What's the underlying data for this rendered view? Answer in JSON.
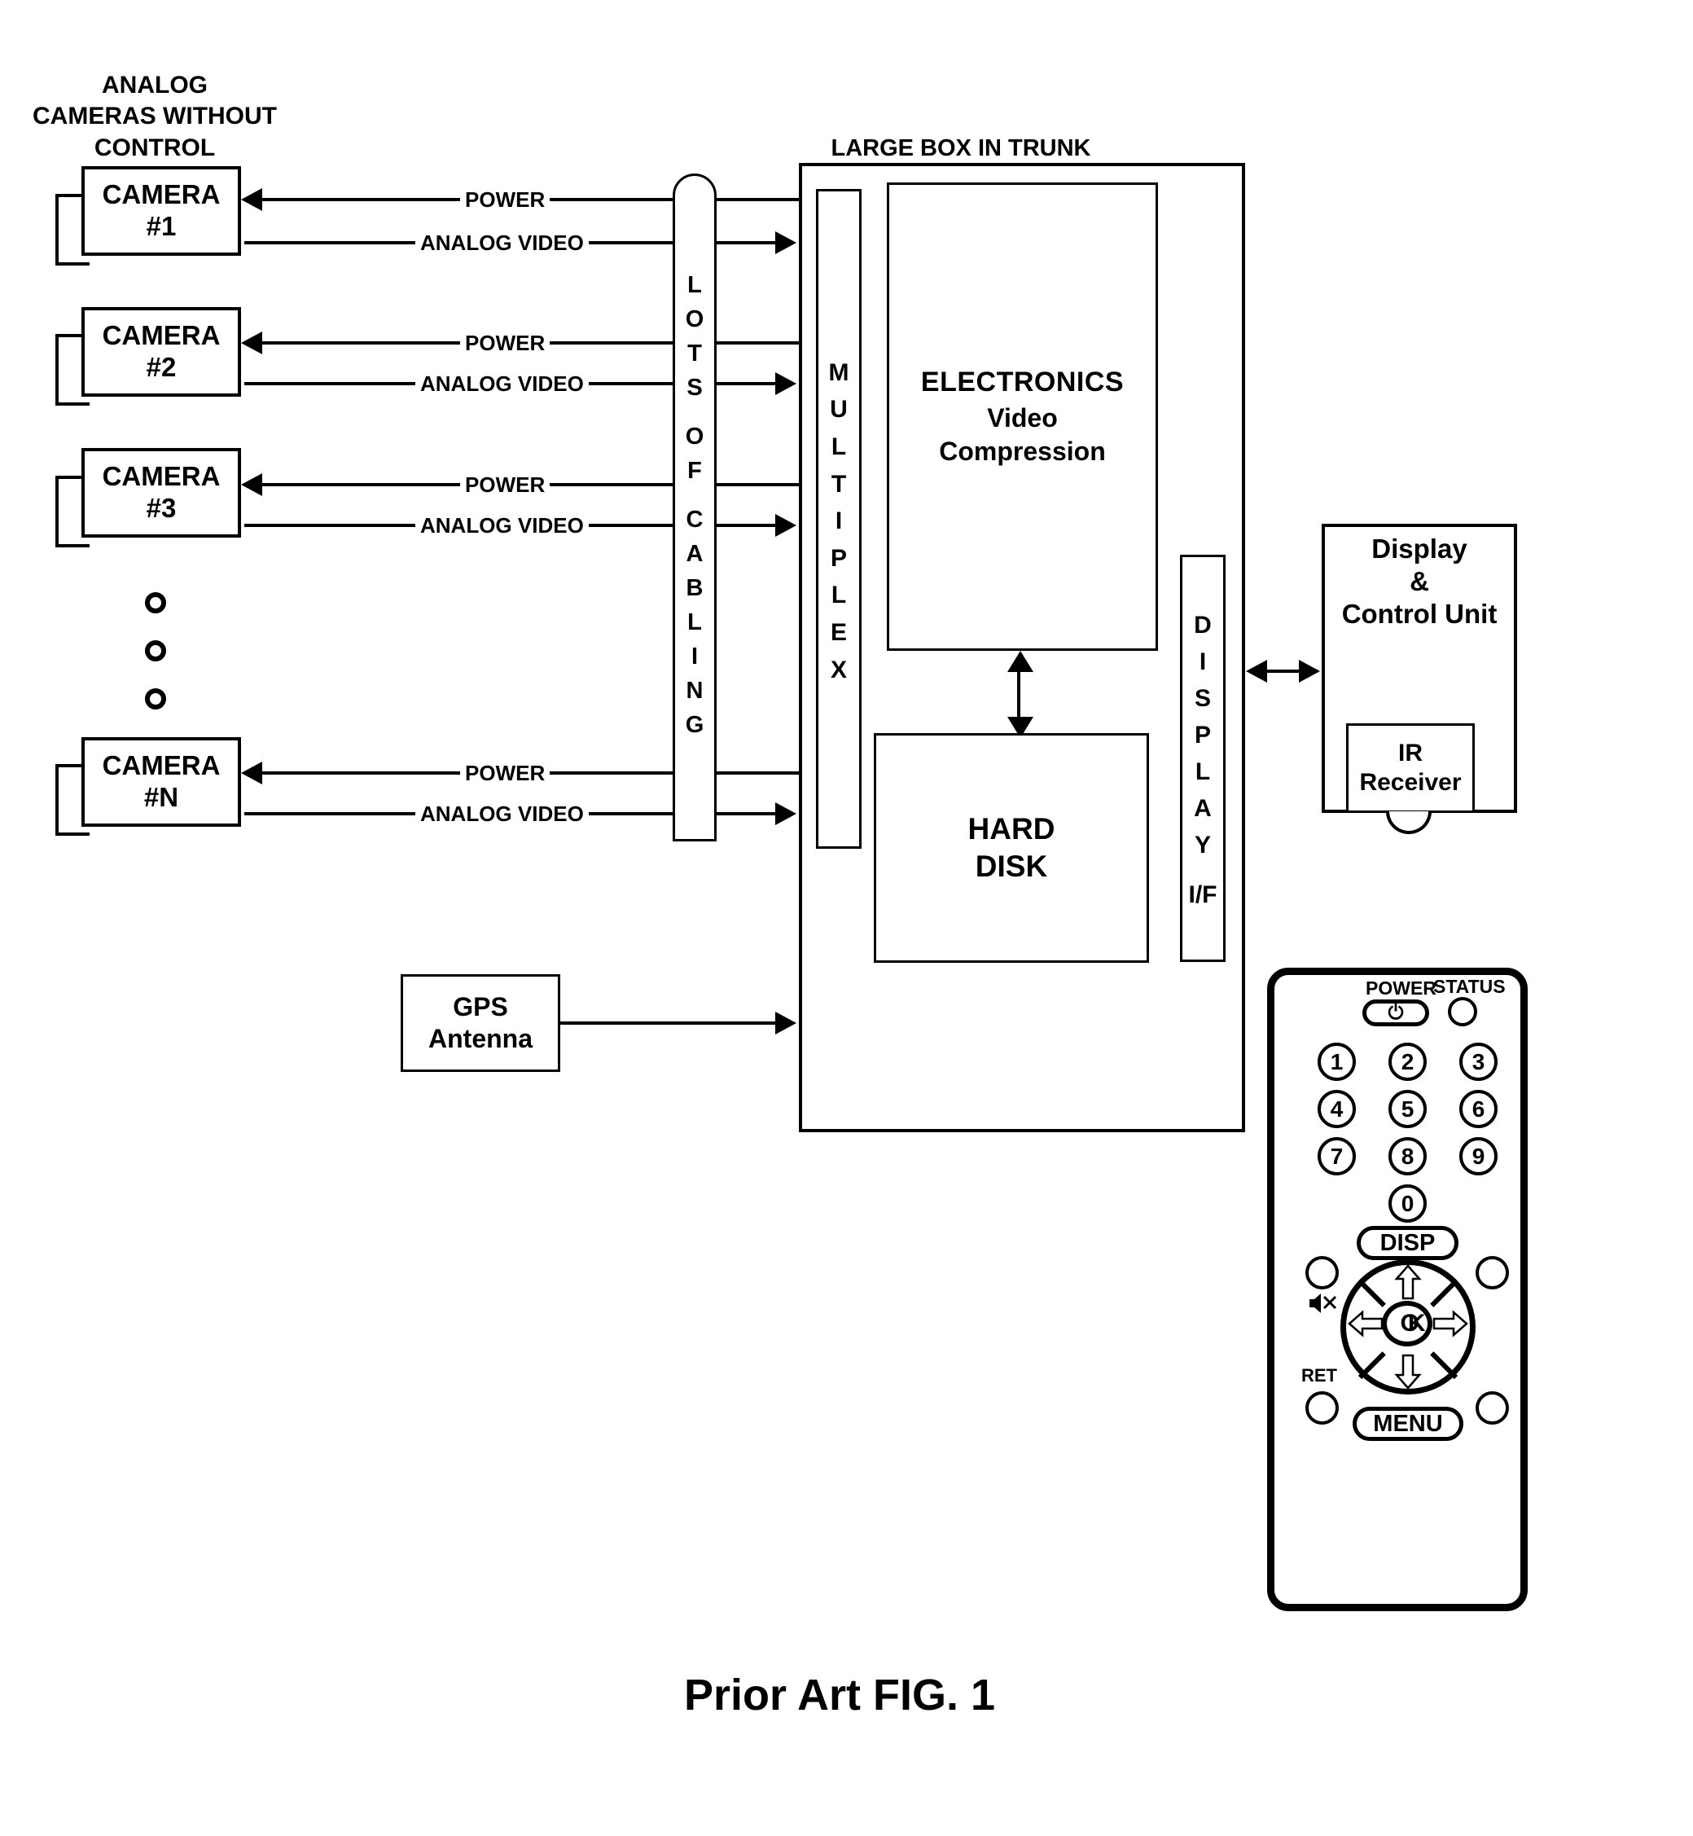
{
  "figure": {
    "title": "Prior Art FIG. 1",
    "left_header": "ANALOG\nCAMERAS WITHOUT\nCONTROL",
    "trunk_header": "LARGE BOX IN TRUNK"
  },
  "cameras": [
    {
      "name": "CAMERA",
      "index": "#1",
      "power_label": "POWER",
      "video_label": "ANALOG VIDEO"
    },
    {
      "name": "CAMERA",
      "index": "#2",
      "power_label": "POWER",
      "video_label": "ANALOG VIDEO"
    },
    {
      "name": "CAMERA",
      "index": "#3",
      "power_label": "POWER",
      "video_label": "ANALOG VIDEO"
    },
    {
      "name": "CAMERA",
      "index": "#N",
      "power_label": "POWER",
      "video_label": "ANALOG VIDEO"
    }
  ],
  "cabling": {
    "letters": [
      "L",
      "O",
      "T",
      "S",
      "",
      "O",
      "F",
      "",
      "C",
      "A",
      "B",
      "L",
      "I",
      "N",
      "G"
    ],
    "text": "LOTS OF CABLING"
  },
  "multiplex": {
    "letters": [
      "M",
      "U",
      "L",
      "T",
      "I",
      "P",
      "L",
      "E",
      "X"
    ],
    "text": "MULTIPLEX"
  },
  "electronics": {
    "line1": "ELECTRONICS",
    "line2": "Video",
    "line3": "Compression"
  },
  "hard_disk": {
    "line1": "HARD",
    "line2": "DISK"
  },
  "display_if": {
    "letters": [
      "D",
      "I",
      "S",
      "P",
      "L",
      "A",
      "Y",
      "",
      "I/F"
    ],
    "text": "DISPLAY I/F"
  },
  "display_unit": {
    "line1": "Display",
    "line2": "&",
    "line3": "Control Unit",
    "ir_line1": "IR",
    "ir_line2": "Receiver"
  },
  "gps": {
    "line1": "GPS",
    "line2": "Antenna"
  },
  "remote": {
    "power_label": "POWER",
    "status_label": "STATUS",
    "power_glyph": "⏻",
    "keys": [
      "1",
      "2",
      "3",
      "4",
      "5",
      "6",
      "7",
      "8",
      "9",
      "0"
    ],
    "disp_label": "DISP",
    "menu_label": "MENU",
    "ret_label": "RET",
    "ok_label": "OK",
    "mute_icon": "mute-icon"
  },
  "colors": {
    "ink": "#000000",
    "paper": "#ffffff"
  }
}
